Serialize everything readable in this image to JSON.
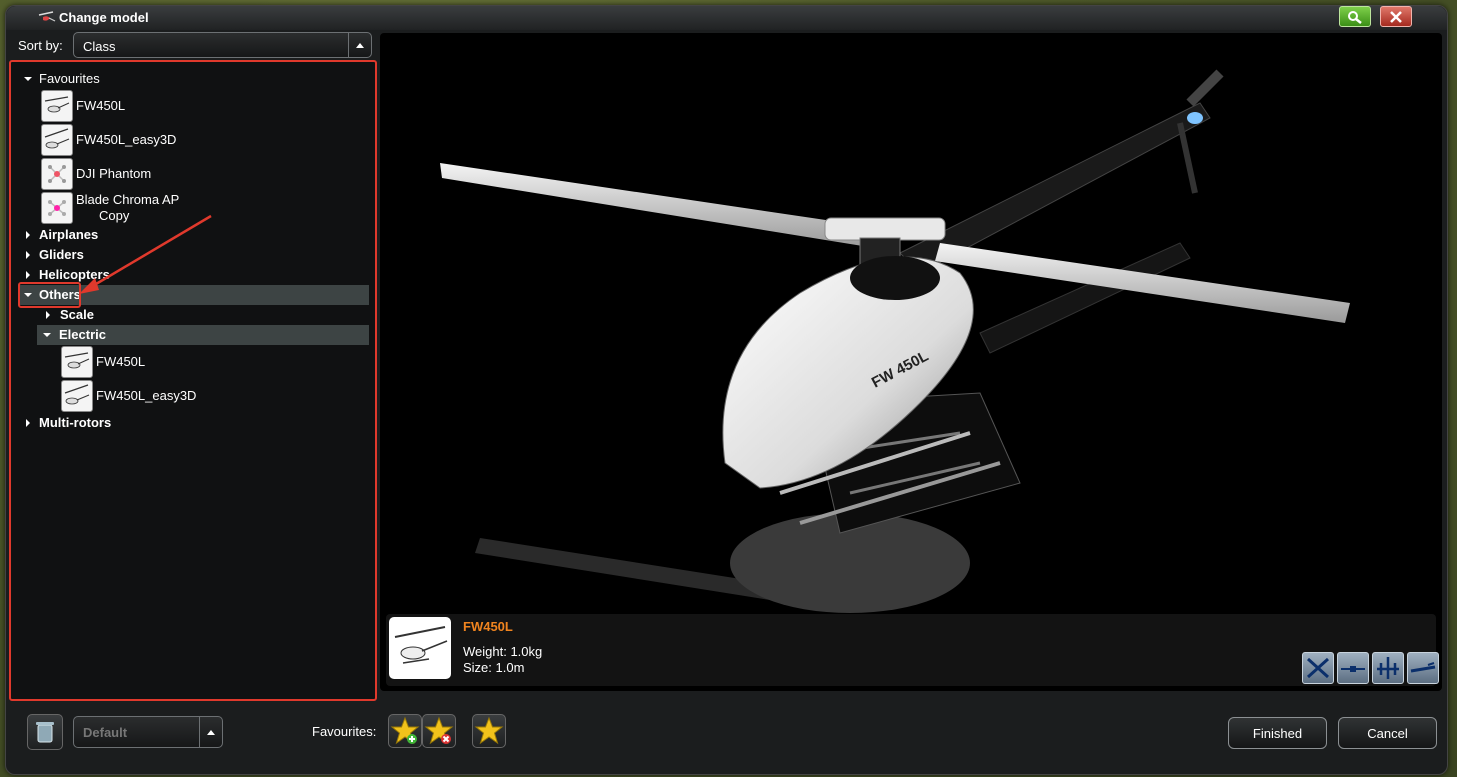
{
  "window": {
    "title": "Change model"
  },
  "titlebar": {
    "search_icon": "search-icon",
    "close_icon": "close-icon"
  },
  "sort": {
    "label": "Sort by:",
    "value": "Class"
  },
  "tree": {
    "favourites": {
      "label": "Favourites",
      "items": [
        {
          "label": "FW450L"
        },
        {
          "label": "FW450L_easy3D"
        },
        {
          "label": "DJI Phantom"
        },
        {
          "label": "Blade Chroma AP",
          "label2": "Copy"
        }
      ]
    },
    "airplanes": "Airplanes",
    "gliders": "Gliders",
    "helicopters": "Helicopters",
    "others": {
      "label": "Others",
      "scale": "Scale",
      "electric": {
        "label": "Electric",
        "items": [
          {
            "label": "FW450L"
          },
          {
            "label": "FW450L_easy3D"
          }
        ]
      }
    },
    "multirotors": "Multi-rotors"
  },
  "preview": {
    "model_name": "FW450L",
    "weight": "Weight: 1.0kg",
    "size": "Size: 1.0m"
  },
  "bottom": {
    "profile_value": "Default",
    "favourites_label": "Favourites:",
    "finished": "Finished",
    "cancel": "Cancel"
  },
  "colors": {
    "accent": "#f0841f",
    "highlight": "#e0392c",
    "selected_row": "#3d4444"
  }
}
